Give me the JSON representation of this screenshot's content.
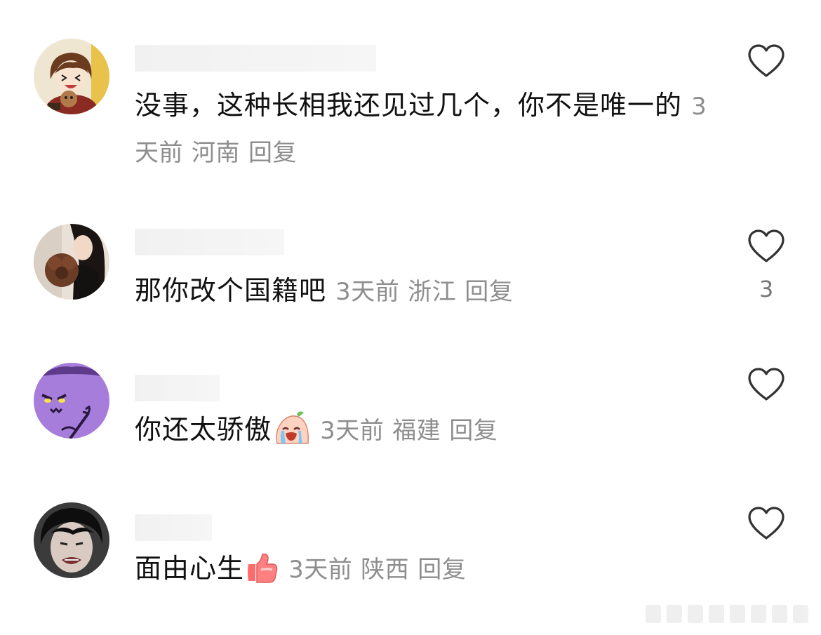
{
  "comments": [
    {
      "text": "没事，这种长相我还见过几个，你不是唯一的",
      "time": "3天前",
      "location": "河南",
      "reply_label": "回复",
      "like_count": ""
    },
    {
      "text": "那你改个国籍吧",
      "time": "3天前",
      "location": "浙江",
      "reply_label": "回复",
      "like_count": "3"
    },
    {
      "text": "你还太骄傲",
      "emoji": "crying-face-emoji",
      "time": "3天前",
      "location": "福建",
      "reply_label": "回复",
      "like_count": ""
    },
    {
      "text": "面由心生",
      "emoji": "thumbs-up-emoji",
      "time": "3天前",
      "location": "陕西",
      "reply_label": "回复",
      "like_count": ""
    }
  ],
  "colors": {
    "text": "#111111",
    "meta": "#8e8e8e",
    "icon": "#333333"
  }
}
